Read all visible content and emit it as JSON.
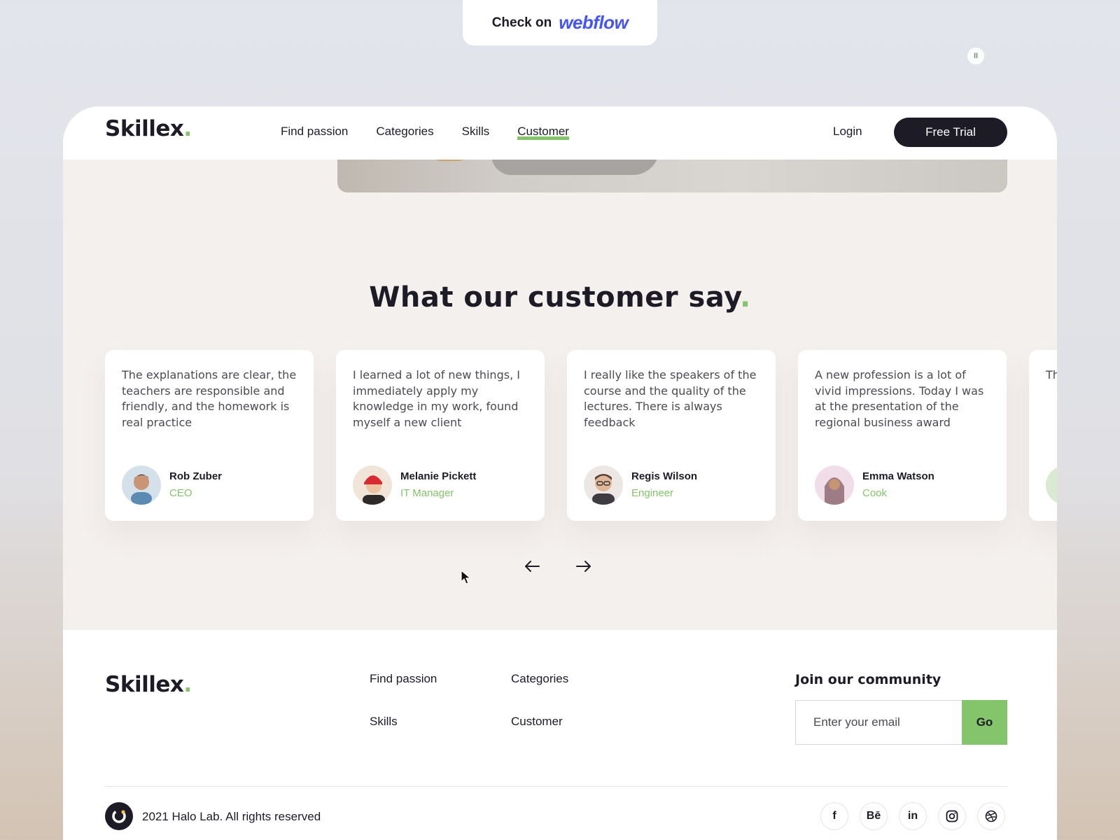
{
  "badge": {
    "label": "Check on",
    "brand": "webflow"
  },
  "header": {
    "logo": "Skillex",
    "logo_dot": ".",
    "nav": [
      "Find passion",
      "Categories",
      "Skills",
      "Customer"
    ],
    "active_nav": "Customer",
    "login": "Login",
    "cta": "Free Trial"
  },
  "video": {
    "pause_icon": "pause-icon"
  },
  "testimonials": {
    "title": "What our customer say",
    "title_dot": ".",
    "items": [
      {
        "quote": "The explanations are clear, the teachers are responsible and friendly, and the homework is real practice",
        "name": "Rob Zuber",
        "role": "CEO"
      },
      {
        "quote": "I learned a lot of new things, I immediately apply my knowledge in my work, found myself a new client",
        "name": "Melanie Pickett",
        "role": "IT Manager"
      },
      {
        "quote": "I really like the speakers of the course and the quality of the lectures. There is always feedback",
        "name": "Regis Wilson",
        "role": "Engineer"
      },
      {
        "quote": "A new profession is a lot of vivid impressions. Today I was at the presentation of the regional business award",
        "name": "Emma Watson",
        "role": "Cook"
      },
      {
        "quote": "Th st m pr",
        "name": "",
        "role": ""
      }
    ],
    "prev_icon": "arrow-left-icon",
    "next_icon": "arrow-right-icon"
  },
  "footer": {
    "logo": "Skillex",
    "logo_dot": ".",
    "nav": [
      "Find passion",
      "Categories",
      "Skills",
      "Customer"
    ],
    "join_title": "Join our community",
    "email_placeholder": "Enter your email",
    "go": "Go",
    "copyright": "2021 Halo Lab. All rights reserved",
    "socials": [
      "facebook-icon",
      "behance-icon",
      "linkedin-icon",
      "instagram-icon",
      "dribbble-icon"
    ],
    "social_labels": {
      "facebook": "f",
      "behance": "Bē",
      "linkedin": "in"
    }
  },
  "colors": {
    "accent": "#84c46a",
    "dark": "#1d1b26",
    "section_bg": "#f4f0ee",
    "webflow": "#4353ff"
  }
}
